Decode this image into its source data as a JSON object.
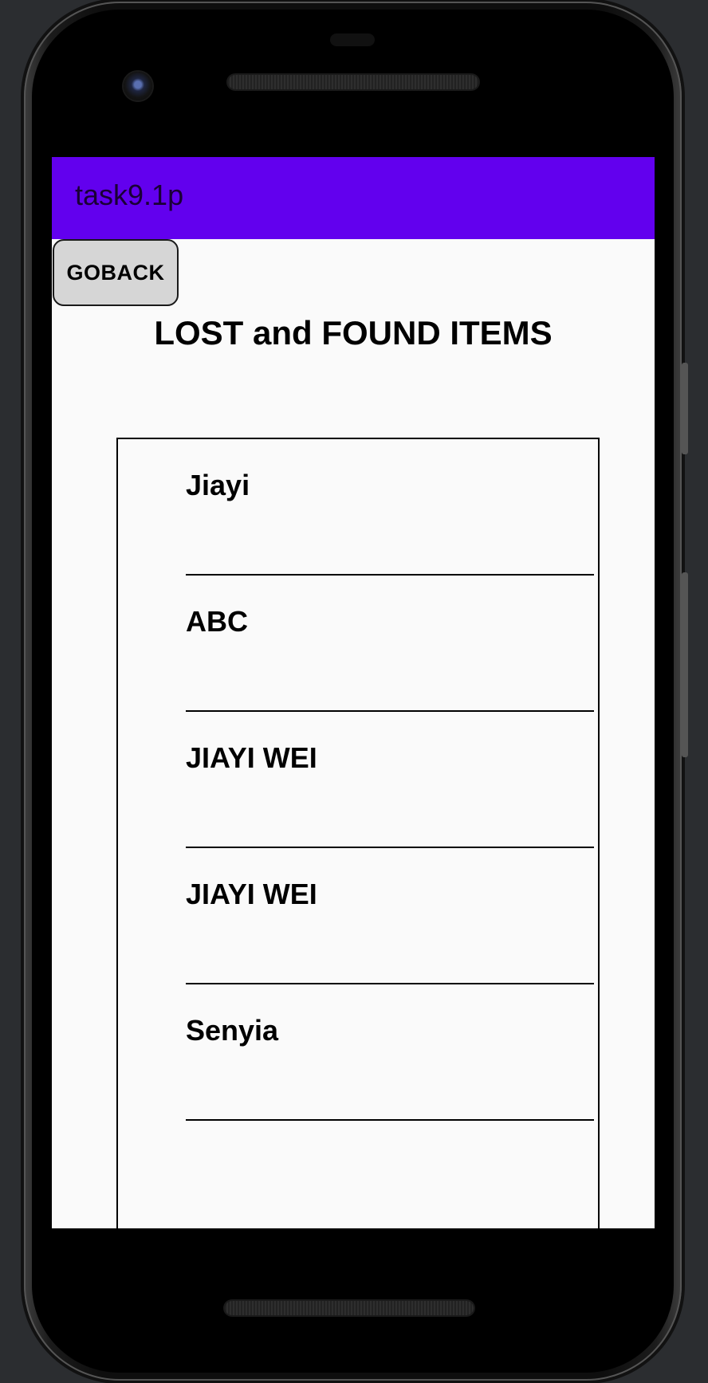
{
  "app": {
    "title": "task9.1p",
    "accent_color": "#6200ee"
  },
  "toolbar": {
    "goback_label": "GOBACK"
  },
  "page": {
    "title": "LOST and FOUND ITEMS"
  },
  "items": [
    {
      "name": "Jiayi"
    },
    {
      "name": "ABC"
    },
    {
      "name": "JIAYI WEI"
    },
    {
      "name": "JIAYI WEI"
    },
    {
      "name": "Senyia"
    }
  ]
}
